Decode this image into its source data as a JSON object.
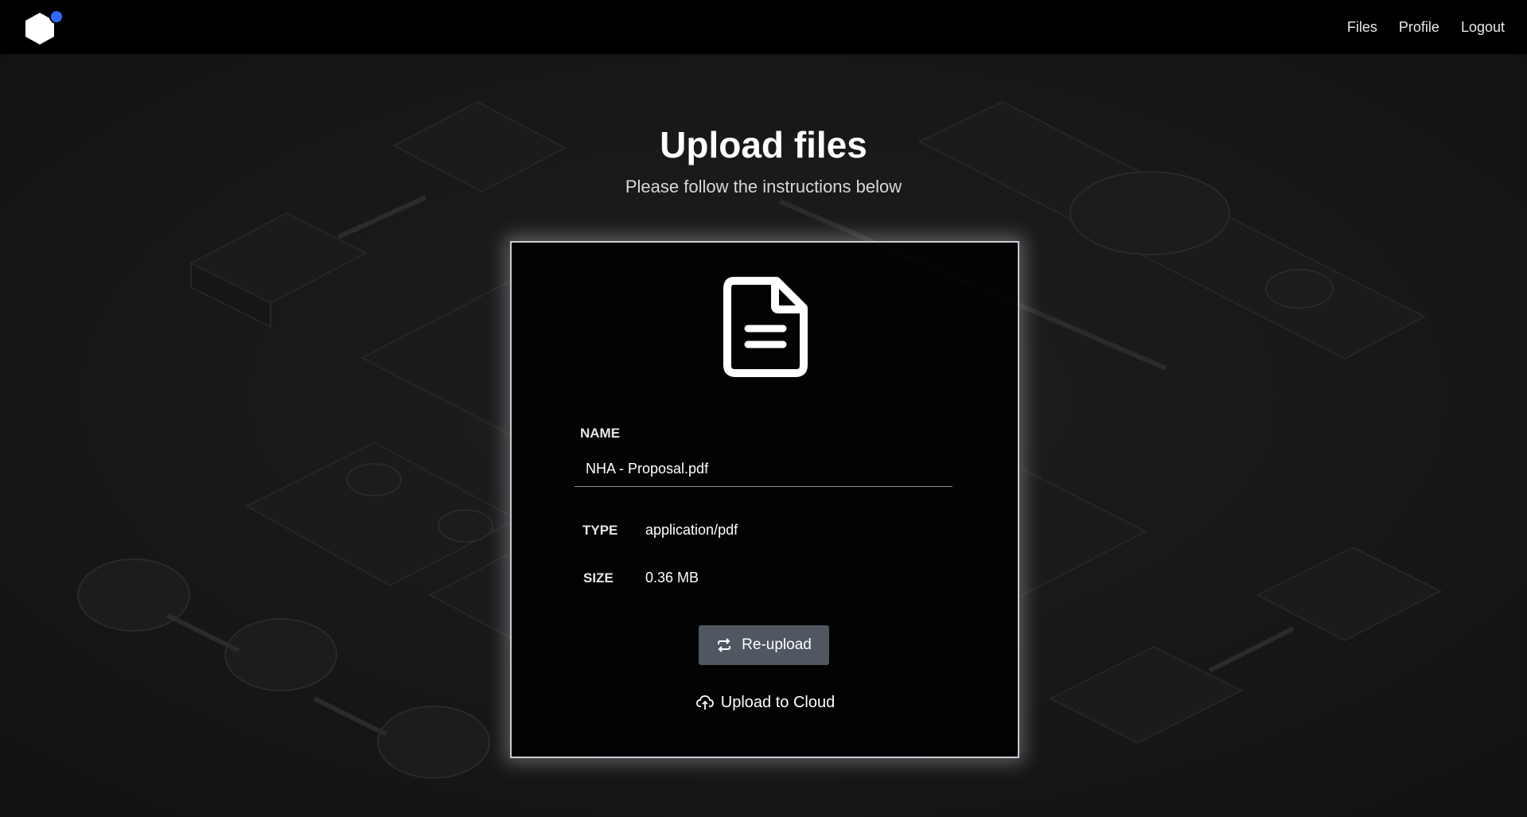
{
  "nav": {
    "links": [
      "Files",
      "Profile",
      "Logout"
    ],
    "accent_color": "#2f6bff"
  },
  "header": {
    "title": "Upload files",
    "subtitle": "Please follow the instructions below"
  },
  "file_card": {
    "icon": "file-text-icon",
    "name_label": "NAME",
    "name_value": "NHA - Proposal.pdf",
    "type_label": "TYPE",
    "type_value": "application/pdf",
    "size_label": "SIZE",
    "size_value": "0.36 MB",
    "reupload_label": "Re-upload",
    "reupload_icon": "repeat-icon",
    "upload_label": "Upload to Cloud",
    "upload_icon": "cloud-upload-icon"
  }
}
